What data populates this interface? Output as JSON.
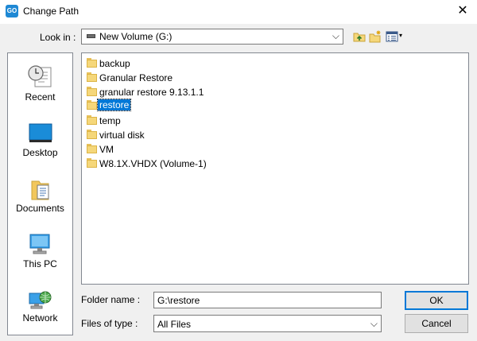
{
  "window": {
    "title": "Change Path",
    "app_icon_text": "GO",
    "close_glyph": "✕"
  },
  "look_in": {
    "label": "Look in :",
    "value": "New Volume (G:)",
    "arrow": "⌵"
  },
  "toolbar": {
    "icons": [
      "up-one-level-icon",
      "create-new-folder-icon",
      "view-menu-icon"
    ],
    "views_arrow": "▾"
  },
  "sidebar": {
    "items": [
      {
        "label": "Recent",
        "icon": "recent-icon"
      },
      {
        "label": "Desktop",
        "icon": "desktop-icon"
      },
      {
        "label": "Documents",
        "icon": "documents-icon"
      },
      {
        "label": "This PC",
        "icon": "this-pc-icon"
      },
      {
        "label": "Network",
        "icon": "network-icon"
      }
    ]
  },
  "files": [
    {
      "name": "backup",
      "selected": false
    },
    {
      "name": "Granular Restore",
      "selected": false
    },
    {
      "name": "granular restore 9.13.1.1",
      "selected": false
    },
    {
      "name": "restore",
      "selected": true
    },
    {
      "name": "temp",
      "selected": false
    },
    {
      "name": "virtual disk",
      "selected": false
    },
    {
      "name": "VM",
      "selected": false
    },
    {
      "name": "W8.1X.VHDX (Volume-1)",
      "selected": false
    }
  ],
  "folder_name": {
    "label": "Folder name :",
    "value": "G:\\restore"
  },
  "files_of_type": {
    "label": "Files of type :",
    "value": "All Files",
    "arrow": "⌵"
  },
  "buttons": {
    "ok": "OK",
    "cancel": "Cancel"
  },
  "colors": {
    "selection": "#0078d7",
    "folder": "#f5d77a",
    "window_bg": "#f0f0f0"
  }
}
